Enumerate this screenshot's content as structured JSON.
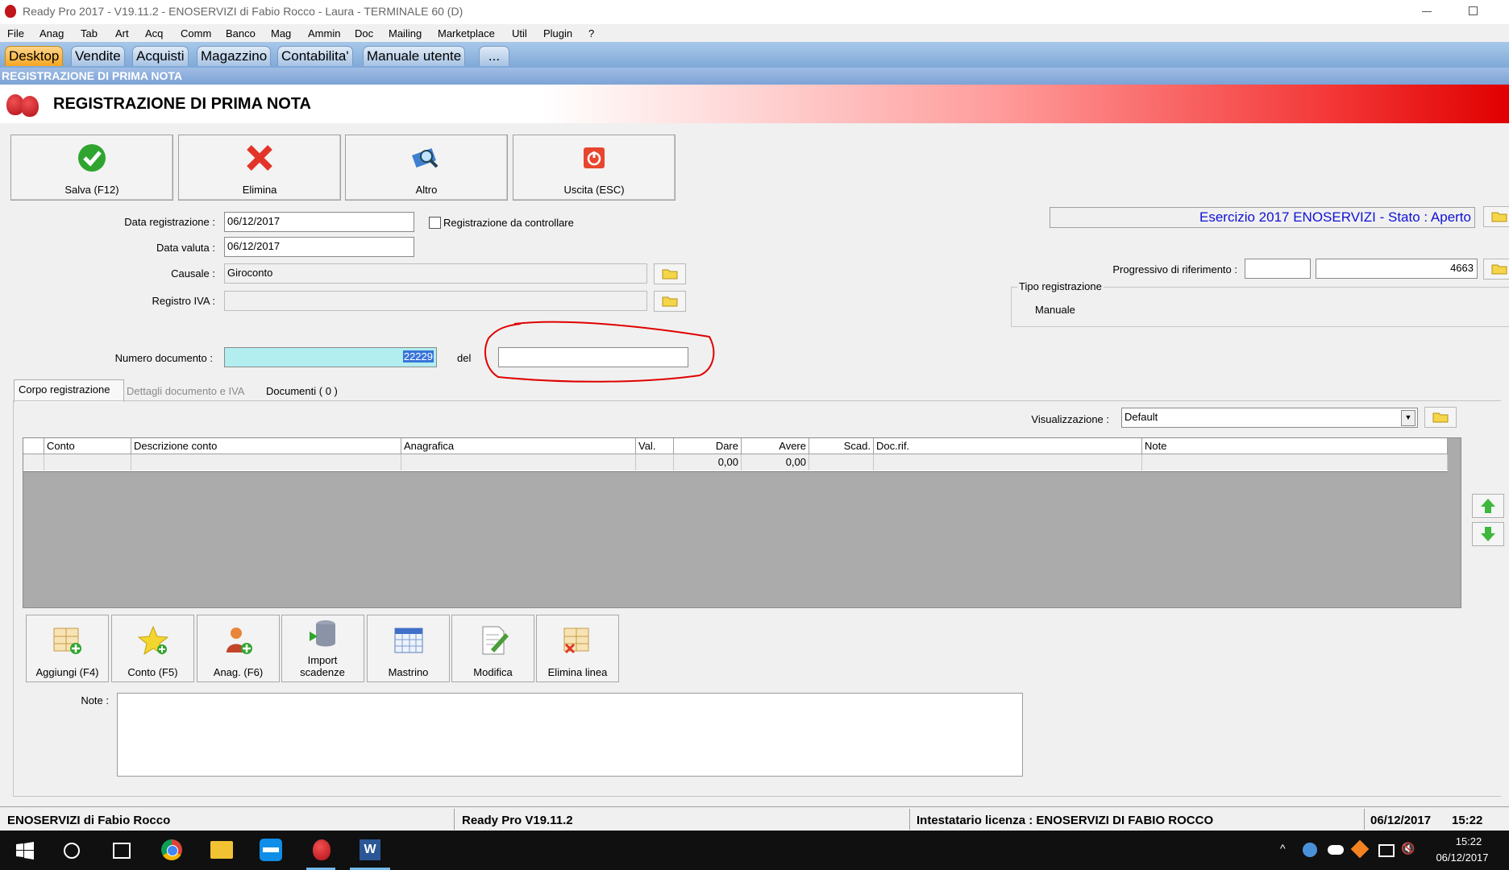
{
  "window": {
    "title": "Ready Pro 2017 - V19.11.2 - ENOSERVIZI di Fabio Rocco - Laura - TERMINALE 60 (D)"
  },
  "menu": [
    "File",
    "Anag",
    "Tab",
    "Art",
    "Acq",
    "Comm",
    "Banco",
    "Mag",
    "Ammin",
    "Doc",
    "Mailing",
    "Marketplace",
    "Util",
    "Plugin",
    "?"
  ],
  "tabs": [
    "Desktop",
    "Vendite",
    "Acquisti",
    "Magazzino",
    "Contabilita'",
    "Manuale utente",
    "..."
  ],
  "subheader": "REGISTRAZIONE DI PRIMA NOTA",
  "banner_title": "REGISTRAZIONE DI PRIMA NOTA",
  "toolbar": {
    "save": "Salva (F12)",
    "delete": "Elimina",
    "other": "Altro",
    "exit": "Uscita (ESC)"
  },
  "form": {
    "data_reg_label": "Data registrazione :",
    "data_reg": "06/12/2017",
    "check_label": "Registrazione da controllare",
    "data_val_label": "Data valuta :",
    "data_val": "06/12/2017",
    "causale_label": "Causale :",
    "causale": "Giroconto",
    "registro_label": "Registro IVA :",
    "registro": "",
    "numdoc_label": "Numero documento :",
    "numdoc": "22229",
    "del_label": "del",
    "del_value": ""
  },
  "esercizio": "Esercizio 2017 ENOSERVIZI - Stato : Aperto",
  "progressivo_label": "Progressivo di riferimento :",
  "progressivo_a": "",
  "progressivo_b": "4663",
  "tipo_label": "Tipo registrazione",
  "tipo_value": "Manuale",
  "subtabs": [
    "Corpo registrazione",
    "Dettagli documento e IVA",
    "Documenti ( 0 )"
  ],
  "visual_label": "Visualizzazione :",
  "visual_value": "Default",
  "grid": {
    "headers": [
      "Conto",
      "Descrizione conto",
      "Anagrafica",
      "Val.",
      "Dare",
      "Avere",
      "Scad.",
      "Doc.rif.",
      "Note"
    ],
    "dare": "0,00",
    "avere": "0,00"
  },
  "actions": [
    "Aggiungi (F4)",
    "Conto (F5)",
    "Anag. (F6)",
    "Import scadenze",
    "Mastrino",
    "Modifica",
    "Elimina linea"
  ],
  "note_label": "Note :",
  "status": {
    "company": "ENOSERVIZI di Fabio Rocco",
    "version": "Ready Pro V19.11.2",
    "license": "Intestatario licenza : ENOSERVIZI DI FABIO ROCCO",
    "date": "06/12/2017",
    "time": "15:22"
  },
  "clock": {
    "time": "15:22",
    "date": "06/12/2017"
  },
  "colors": {
    "accent": "#0000ff",
    "tab_active": "#f5a623",
    "banner_red": "#e00000",
    "annotation": "#e00000",
    "numdoc_bg": "#b2eef0"
  }
}
